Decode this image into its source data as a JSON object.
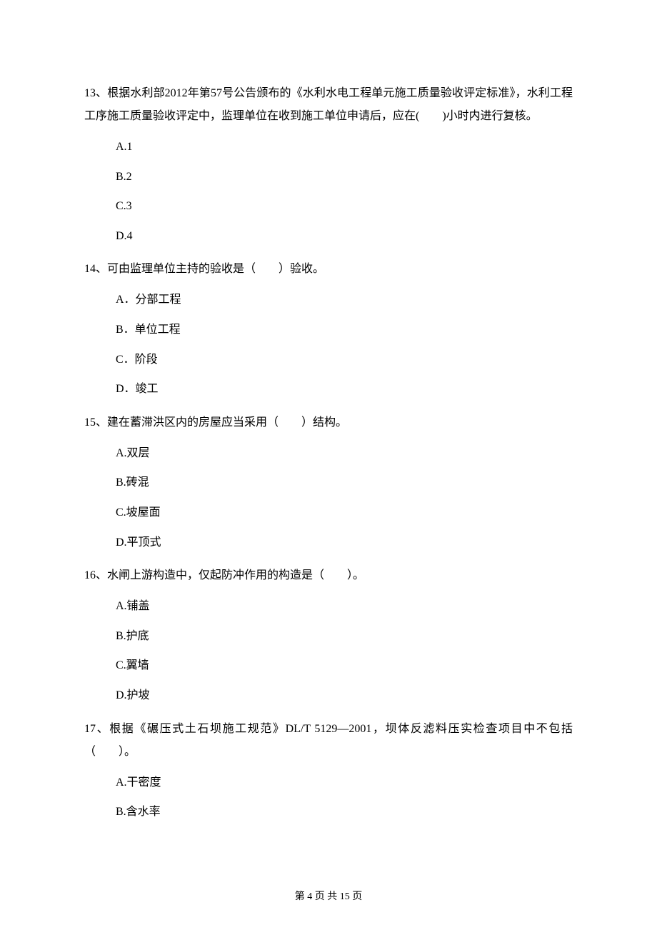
{
  "questions": [
    {
      "num": "13、",
      "text": "根据水利部2012年第57号公告颁布的《水利水电工程单元施工质量验收评定标准》，水利工程工序施工质量验收评定中，监理单位在收到施工单位申请后，应在(　　)小时内进行复核。",
      "options": [
        "A.1",
        "B.2",
        "C.3",
        "D.4"
      ]
    },
    {
      "num": "14、",
      "text": "可由监理单位主持的验收是（　　）验收。",
      "options": [
        "A．分部工程",
        "B．单位工程",
        "C．阶段",
        "D．竣工"
      ]
    },
    {
      "num": "15、",
      "text": "建在蓄滞洪区内的房屋应当采用（　　）结构。",
      "options": [
        "A.双层",
        "B.砖混",
        "C.坡屋面",
        "D.平顶式"
      ]
    },
    {
      "num": "16、",
      "text": "水闸上游构造中，仅起防冲作用的构造是（　　）。",
      "options": [
        "A.铺盖",
        "B.护底",
        "C.翼墙",
        "D.护坡"
      ]
    },
    {
      "num": "17、",
      "text": "根据《碾压式土石坝施工规范》DL/T 5129—2001，坝体反滤料压实检查项目中不包括（　　）。",
      "options": [
        "A.干密度",
        "B.含水率"
      ]
    }
  ],
  "footer": "第 4 页 共 15 页"
}
